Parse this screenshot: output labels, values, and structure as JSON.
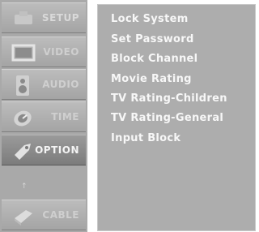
{
  "sidebar": {
    "items": [
      {
        "label": "SETUP",
        "icon": "setup-icon"
      },
      {
        "label": "VIDEO",
        "icon": "monitor-icon"
      },
      {
        "label": "AUDIO",
        "icon": "speaker-icon"
      },
      {
        "label": "TIME",
        "icon": "clock-icon"
      },
      {
        "label": "OPTION",
        "icon": "tag-icon"
      },
      {
        "label": "CABLE",
        "icon": "cable-icon"
      }
    ],
    "scroll_arrow": "↑"
  },
  "menu": {
    "items": [
      "Lock System",
      "Set Password",
      "Block Channel",
      "Movie Rating",
      "TV Rating-Children",
      "TV Rating-General",
      "Input Block"
    ]
  }
}
